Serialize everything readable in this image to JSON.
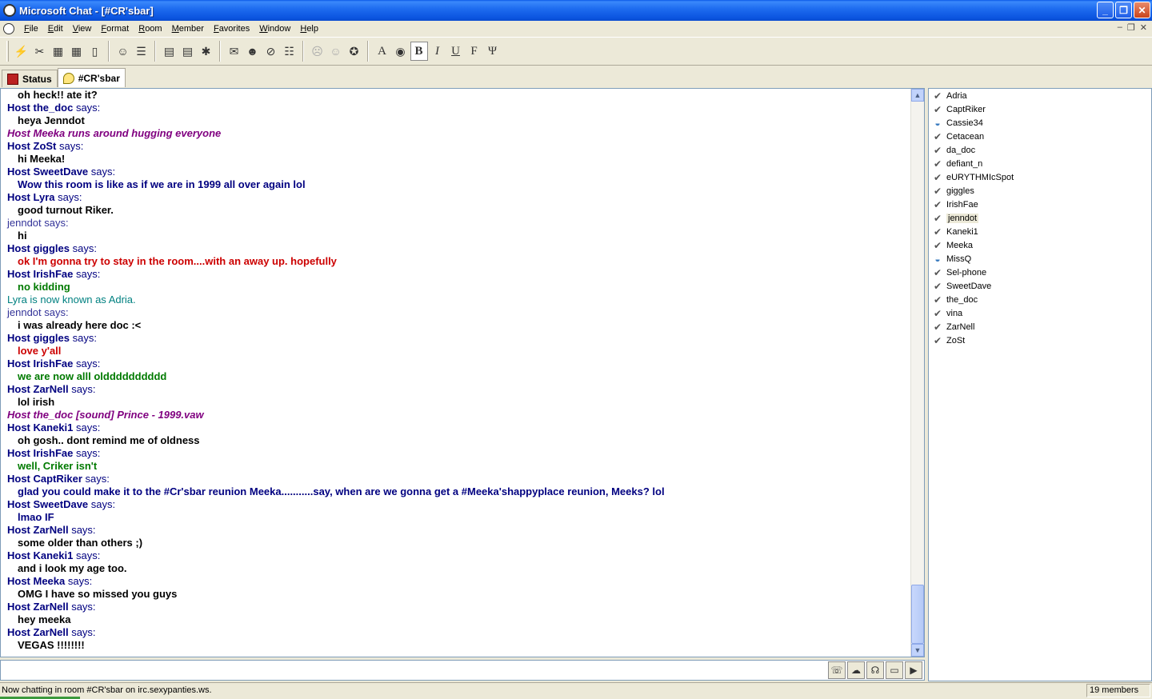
{
  "window": {
    "title": "Microsoft Chat - [#CR'sbar]"
  },
  "menu": {
    "items": [
      "File",
      "Edit",
      "View",
      "Format",
      "Room",
      "Member",
      "Favorites",
      "Window",
      "Help"
    ]
  },
  "toolbar": {
    "buttons": [
      {
        "name": "connect-icon",
        "glyph": "⚡",
        "disabled": true
      },
      {
        "name": "disconnect-icon",
        "glyph": "✂",
        "disabled": false
      },
      {
        "name": "enter-room-icon",
        "glyph": "▦",
        "disabled": false
      },
      {
        "name": "leave-room-icon",
        "glyph": "▦",
        "disabled": false
      },
      {
        "name": "room-list-icon",
        "glyph": "▯",
        "disabled": false
      },
      {
        "name": "comic-view-icon",
        "glyph": "☺",
        "disabled": false
      },
      {
        "name": "text-view-icon",
        "glyph": "☰",
        "disabled": false
      },
      {
        "name": "room-properties-icon",
        "glyph": "▤",
        "disabled": false
      },
      {
        "name": "user-list-icon",
        "glyph": "▤",
        "disabled": false
      },
      {
        "name": "favorites-icon",
        "glyph": "✱",
        "disabled": false
      },
      {
        "name": "send-mail-icon",
        "glyph": "✉",
        "disabled": false
      },
      {
        "name": "get-identity-icon",
        "glyph": "☻",
        "disabled": false
      },
      {
        "name": "ignore-icon",
        "glyph": "⊘",
        "disabled": false
      },
      {
        "name": "member-properties-icon",
        "glyph": "☷",
        "disabled": false
      },
      {
        "name": "whisper-icon",
        "glyph": "☹",
        "disabled": true
      },
      {
        "name": "think-icon",
        "glyph": "☺",
        "disabled": true
      },
      {
        "name": "netmeeting-icon",
        "glyph": "✪",
        "disabled": false
      },
      {
        "name": "font-icon",
        "glyph": "A",
        "disabled": false,
        "fmt": true
      },
      {
        "name": "color-icon",
        "glyph": "◉",
        "disabled": false
      },
      {
        "name": "bold-icon",
        "glyph": "B",
        "disabled": false,
        "fmt": true,
        "pressed": true
      },
      {
        "name": "italic-icon",
        "glyph": "I",
        "disabled": false,
        "fmt": true
      },
      {
        "name": "underline-icon",
        "glyph": "U",
        "disabled": false,
        "fmt": true
      },
      {
        "name": "fixed-font-icon",
        "glyph": "F",
        "disabled": false,
        "fmt": true
      },
      {
        "name": "symbol-font-icon",
        "glyph": "Ψ",
        "disabled": false,
        "fmt": true
      }
    ]
  },
  "tabs": [
    {
      "label": "Status",
      "active": false
    },
    {
      "label": "#CR'sbar",
      "active": true
    }
  ],
  "chat": {
    "lines": [
      {
        "kind": "msg",
        "color": "black",
        "text": "oh heck!! ate it?"
      },
      {
        "kind": "speaker",
        "host": true,
        "name": "Host the_doc",
        "says": " says:"
      },
      {
        "kind": "msg",
        "color": "black",
        "text": "heya Jenndot"
      },
      {
        "kind": "action",
        "text": "Host Meeka runs around hugging everyone"
      },
      {
        "kind": "speaker",
        "host": true,
        "name": "Host ZoSt",
        "says": " says:"
      },
      {
        "kind": "msg",
        "color": "black",
        "text": "hi Meeka!"
      },
      {
        "kind": "speaker",
        "host": true,
        "name": "Host SweetDave",
        "says": " says:"
      },
      {
        "kind": "msg",
        "color": "blue",
        "text": "Wow this room is like as if we are in 1999 all over again lol"
      },
      {
        "kind": "speaker",
        "host": true,
        "name": "Host Lyra",
        "says": " says:"
      },
      {
        "kind": "msg",
        "color": "black",
        "text": "good turnout Riker."
      },
      {
        "kind": "plain-speaker",
        "text": "jenndot says:"
      },
      {
        "kind": "msg",
        "color": "plain",
        "text": "hi"
      },
      {
        "kind": "speaker",
        "host": true,
        "name": "Host giggles",
        "says": " says:"
      },
      {
        "kind": "msg",
        "color": "red",
        "text": "ok I'm gonna try to stay in the room....with an away up. hopefully"
      },
      {
        "kind": "speaker",
        "host": true,
        "name": "Host IrishFae",
        "says": " says:"
      },
      {
        "kind": "msg",
        "color": "green",
        "text": "no kidding"
      },
      {
        "kind": "notice",
        "text": "Lyra is now known as Adria."
      },
      {
        "kind": "plain-speaker",
        "text": "jenndot says:"
      },
      {
        "kind": "msg",
        "color": "plain",
        "text": "i was already here doc :<"
      },
      {
        "kind": "speaker",
        "host": true,
        "name": "Host giggles",
        "says": " says:"
      },
      {
        "kind": "msg",
        "color": "red",
        "text": "love y'all"
      },
      {
        "kind": "speaker",
        "host": true,
        "name": "Host IrishFae",
        "says": " says:"
      },
      {
        "kind": "msg",
        "color": "green",
        "text": "we are now alll oldddddddddd"
      },
      {
        "kind": "speaker",
        "host": true,
        "name": "Host ZarNell",
        "says": " says:"
      },
      {
        "kind": "msg",
        "color": "black",
        "text": "lol irish"
      },
      {
        "kind": "action",
        "text": "Host the_doc [sound] Prince - 1999.vaw"
      },
      {
        "kind": "speaker",
        "host": true,
        "name": "Host Kaneki1",
        "says": " says:"
      },
      {
        "kind": "msg",
        "color": "black",
        "text": "oh gosh.. dont remind me of oldness"
      },
      {
        "kind": "speaker",
        "host": true,
        "name": "Host IrishFae",
        "says": " says:"
      },
      {
        "kind": "msg",
        "color": "green",
        "text": "well, Criker isn't"
      },
      {
        "kind": "speaker",
        "host": true,
        "name": "Host CaptRiker",
        "says": " says:"
      },
      {
        "kind": "msg",
        "color": "blue",
        "text": "glad you could make it to the #Cr'sbar reunion Meeka...........say, when are we gonna get a #Meeka'shappyplace reunion, Meeks? lol"
      },
      {
        "kind": "speaker",
        "host": true,
        "name": "Host SweetDave",
        "says": " says:"
      },
      {
        "kind": "msg",
        "color": "blue",
        "text": "lmao IF"
      },
      {
        "kind": "speaker",
        "host": true,
        "name": "Host ZarNell",
        "says": " says:"
      },
      {
        "kind": "msg",
        "color": "black",
        "text": "some older than others ;)"
      },
      {
        "kind": "speaker",
        "host": true,
        "name": "Host Kaneki1",
        "says": " says:"
      },
      {
        "kind": "msg",
        "color": "black",
        "text": "and i look my age too."
      },
      {
        "kind": "speaker",
        "host": true,
        "name": "Host Meeka",
        "says": " says:"
      },
      {
        "kind": "msg",
        "color": "black",
        "text": "OMG I have so missed you guys"
      },
      {
        "kind": "speaker",
        "host": true,
        "name": "Host ZarNell",
        "says": " says:"
      },
      {
        "kind": "msg",
        "color": "black",
        "text": "hey meeka"
      },
      {
        "kind": "speaker",
        "host": true,
        "name": "Host ZarNell",
        "says": " says:"
      },
      {
        "kind": "msg",
        "color": "black",
        "text": "VEGAS !!!!!!!!"
      }
    ]
  },
  "input": {
    "value": "",
    "send_buttons": [
      {
        "name": "say-button-icon",
        "glyph": "☏"
      },
      {
        "name": "think-button-icon",
        "glyph": "☁"
      },
      {
        "name": "whisper-button-icon",
        "glyph": "☊"
      },
      {
        "name": "action-button-icon",
        "glyph": "▭"
      },
      {
        "name": "sound-button-icon",
        "glyph": "▶"
      }
    ]
  },
  "members": [
    {
      "name": "Adria",
      "icon": "host",
      "selected": false
    },
    {
      "name": "CaptRiker",
      "icon": "host",
      "selected": false
    },
    {
      "name": "Cassie34",
      "icon": "spectator",
      "selected": false
    },
    {
      "name": "Cetacean",
      "icon": "host",
      "selected": false
    },
    {
      "name": "da_doc",
      "icon": "host",
      "selected": false
    },
    {
      "name": "defiant_n",
      "icon": "host",
      "selected": false
    },
    {
      "name": "eURYTHMIcSpot",
      "icon": "host",
      "selected": false
    },
    {
      "name": "giggles",
      "icon": "host",
      "selected": false
    },
    {
      "name": "IrishFae",
      "icon": "host",
      "selected": false
    },
    {
      "name": "jenndot",
      "icon": "participant",
      "selected": true
    },
    {
      "name": "Kaneki1",
      "icon": "host",
      "selected": false
    },
    {
      "name": "Meeka",
      "icon": "host",
      "selected": false
    },
    {
      "name": "MissQ",
      "icon": "spectator",
      "selected": false
    },
    {
      "name": "Sel-phone",
      "icon": "host",
      "selected": false
    },
    {
      "name": "SweetDave",
      "icon": "host",
      "selected": false
    },
    {
      "name": "the_doc",
      "icon": "host",
      "selected": false
    },
    {
      "name": "vina",
      "icon": "host",
      "selected": false
    },
    {
      "name": "ZarNell",
      "icon": "host",
      "selected": false
    },
    {
      "name": "ZoSt",
      "icon": "host",
      "selected": false
    }
  ],
  "status": {
    "text": "Now chatting in room #CR'sbar on irc.sexypanties.ws.",
    "members_count": "19 members"
  },
  "colors": {
    "host_name": "#000080",
    "action": "#800080",
    "notice": "#008080",
    "red": "#cc0000",
    "green": "#007a00"
  }
}
